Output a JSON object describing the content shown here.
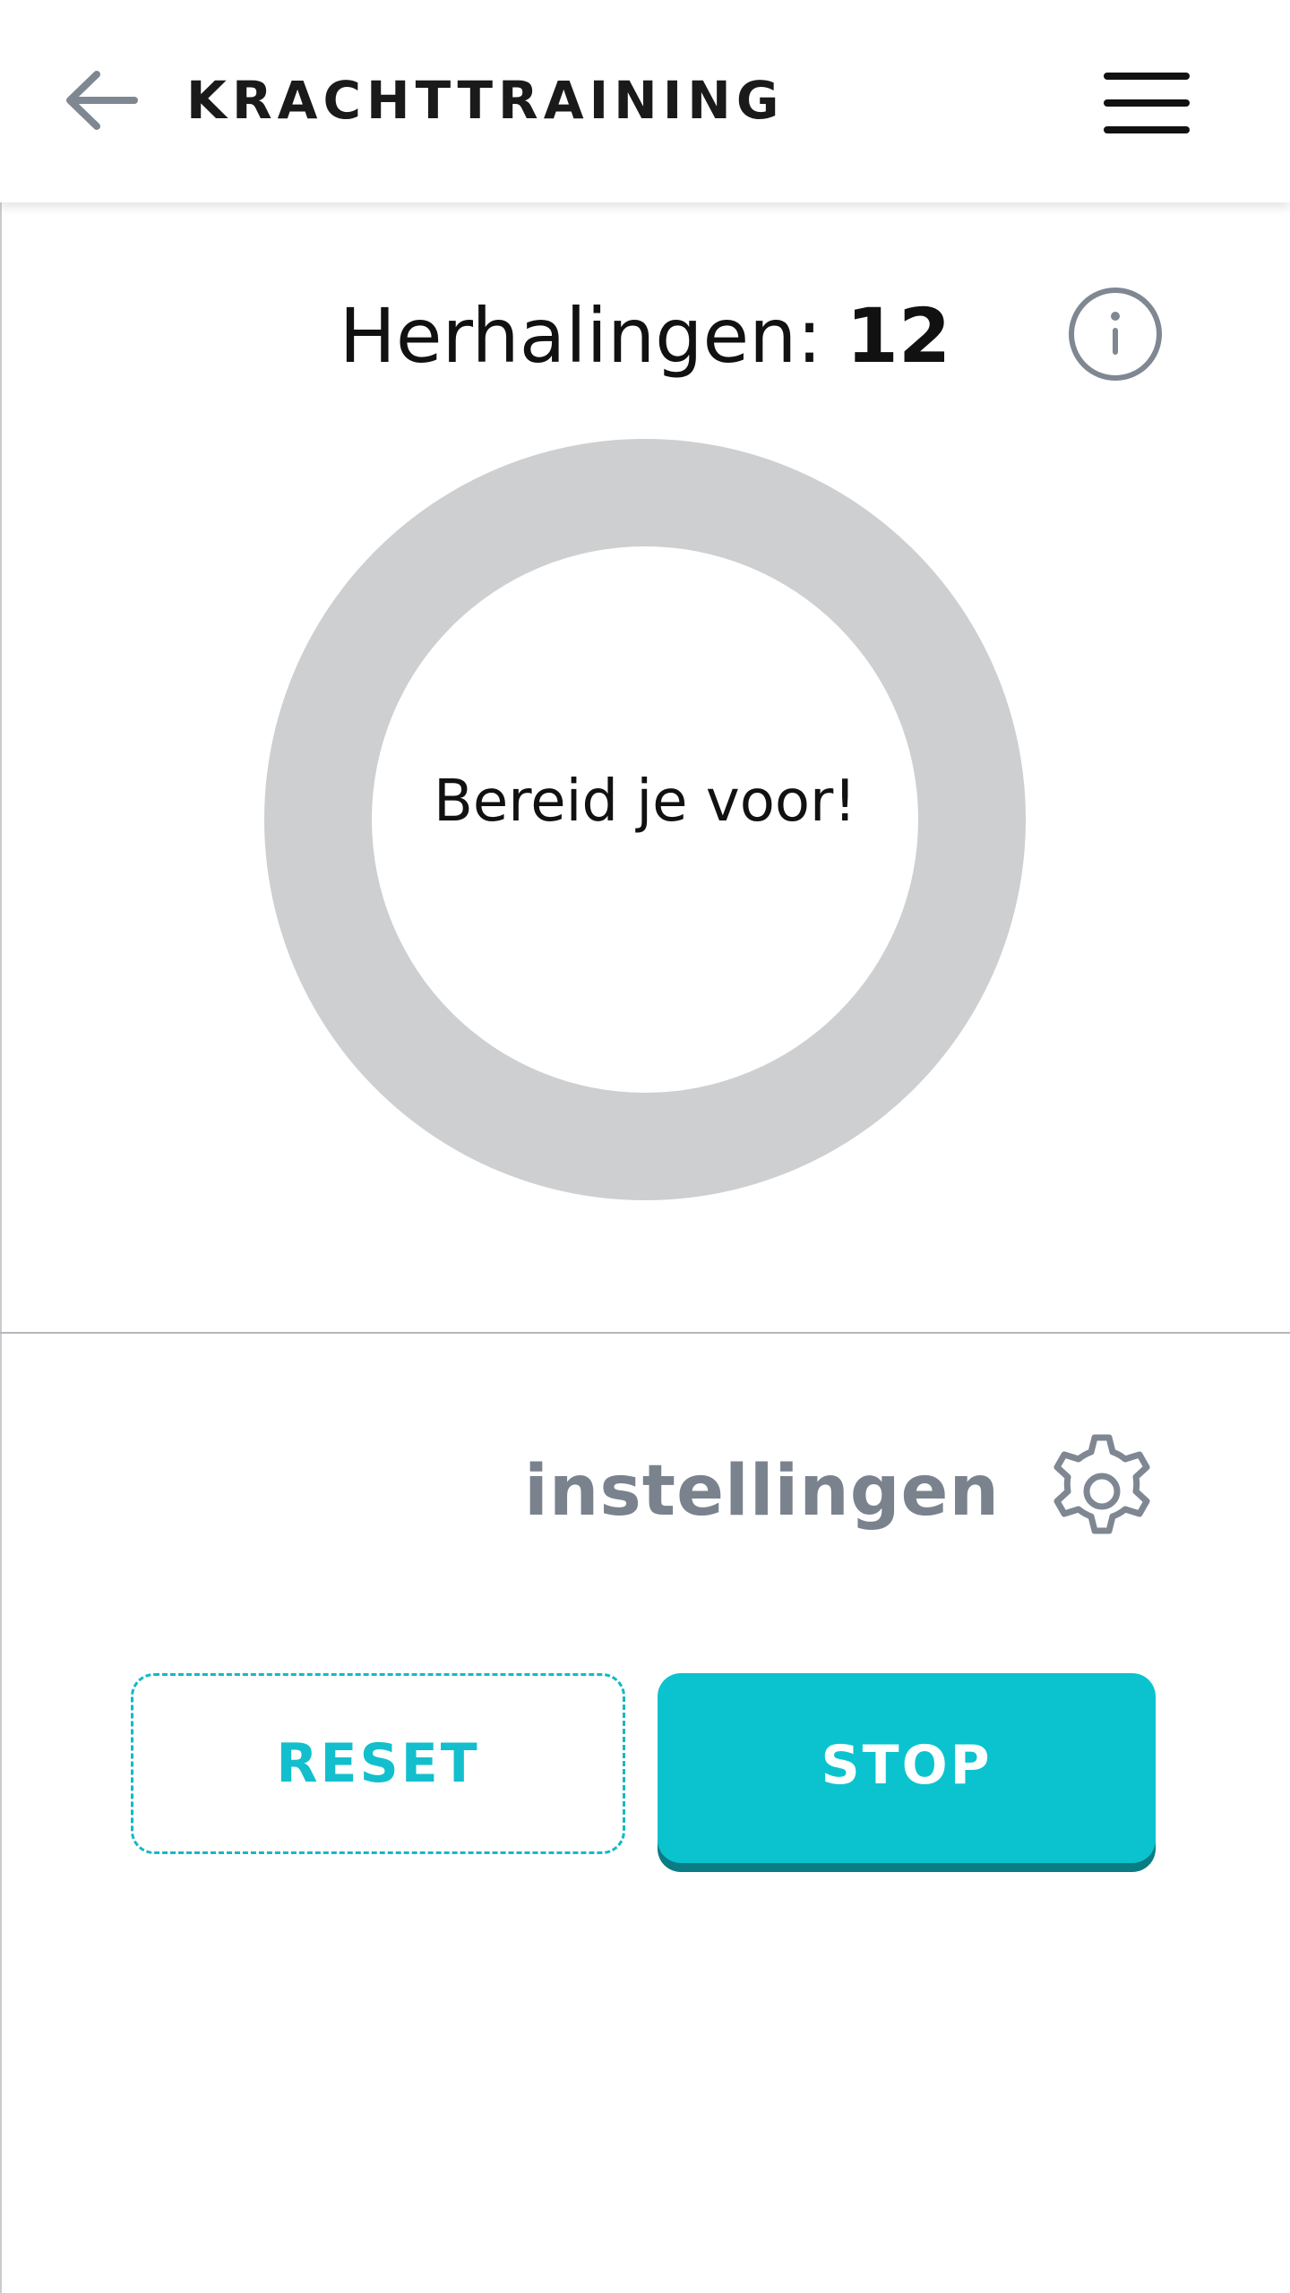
{
  "header": {
    "title": "KRACHTTRAINING",
    "back_icon": "arrow-left-icon",
    "menu_icon": "hamburger-menu-icon"
  },
  "reps": {
    "label": "Herhalingen:",
    "count": "12",
    "info_icon": "info-icon"
  },
  "timer": {
    "status_text": "Bereid je voor!",
    "ring_color": "#cdcfd1"
  },
  "settings": {
    "label": "instellingen",
    "icon": "gear-icon"
  },
  "actions": {
    "reset_label": "RESET",
    "stop_label": "STOP"
  },
  "colors": {
    "accent": "#0bc3ce",
    "accent_dark": "#0b7b84",
    "muted": "#7a828d"
  }
}
